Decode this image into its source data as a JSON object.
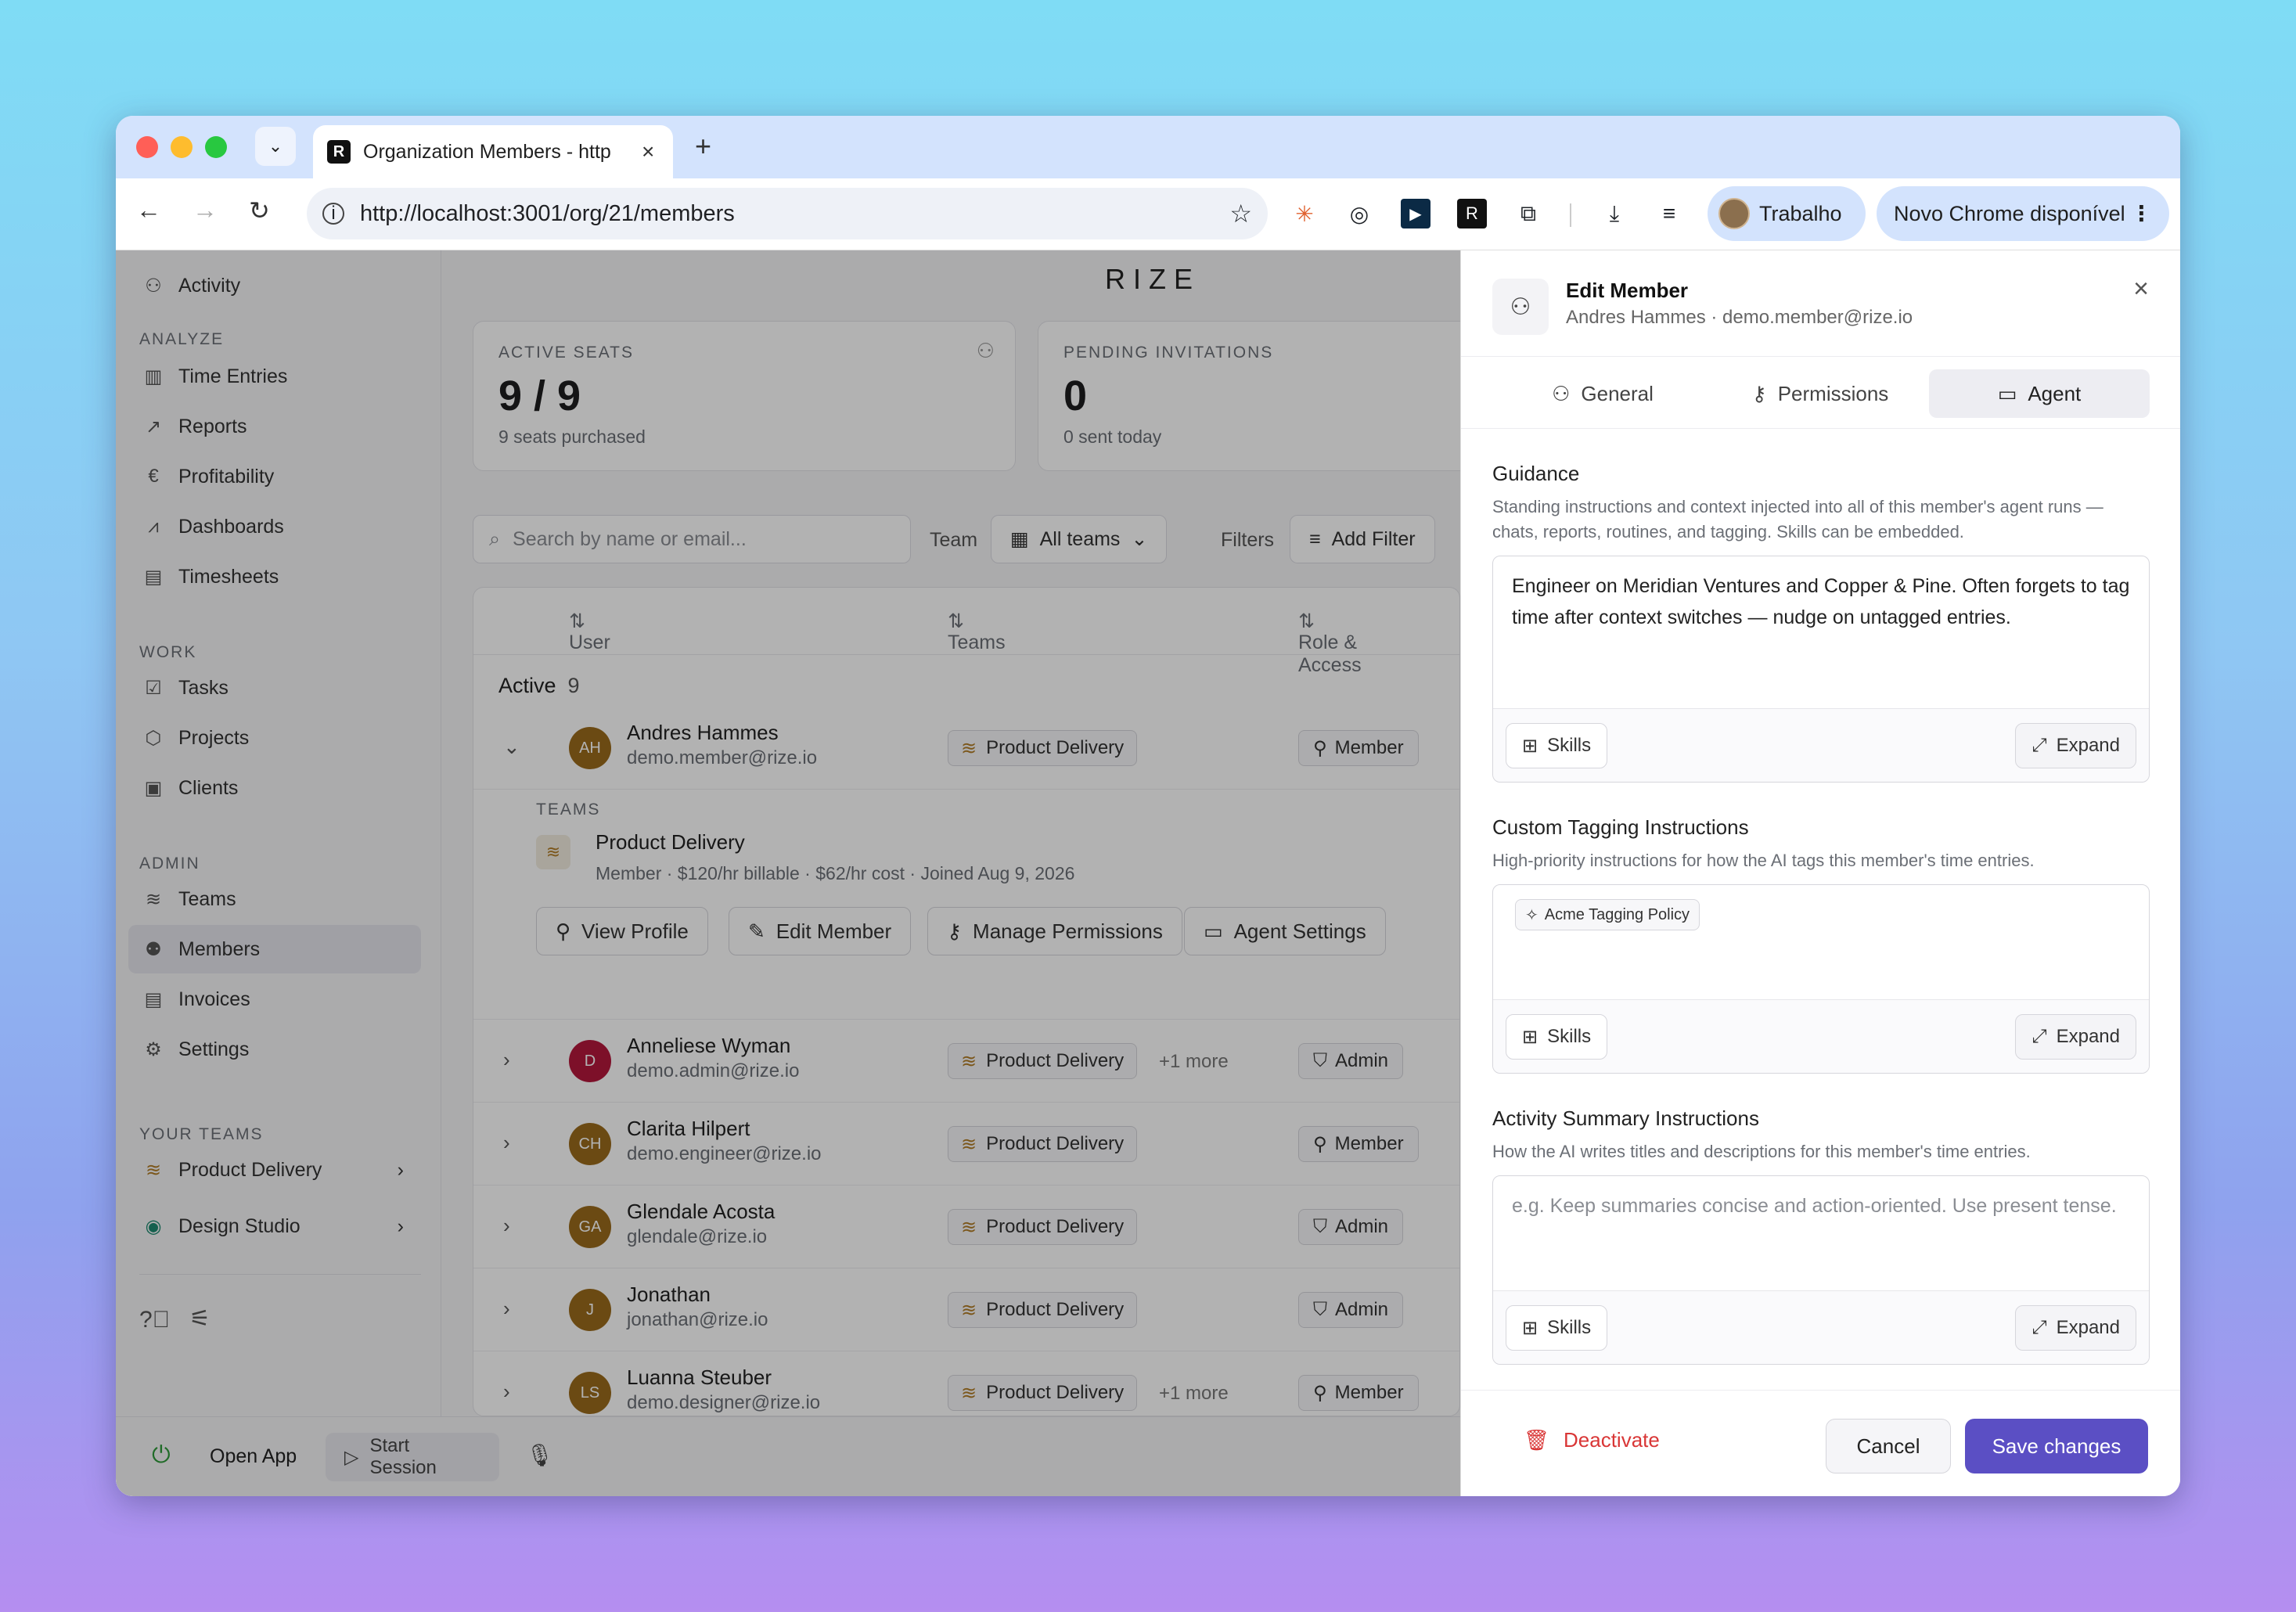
{
  "browser": {
    "tab_title": "Organization Members - http",
    "url": "http://localhost:3001/org/21/members",
    "profile_name": "Trabalho",
    "update_label": "Novo Chrome disponível",
    "favicon_letter": "R"
  },
  "app": {
    "logo": "RIZE",
    "sidebar": {
      "top_item": "Activity",
      "sections": [
        {
          "title": "ANALYZE",
          "items": [
            "Time Entries",
            "Reports",
            "Profitability",
            "Dashboards",
            "Timesheets"
          ]
        },
        {
          "title": "WORK",
          "items": [
            "Tasks",
            "Projects",
            "Clients"
          ]
        },
        {
          "title": "ADMIN",
          "items": [
            "Teams",
            "Members",
            "Invoices",
            "Settings"
          ]
        },
        {
          "title": "YOUR TEAMS",
          "items": [
            "Product Delivery",
            "Design Studio"
          ]
        }
      ]
    },
    "bottom": {
      "open_app": "Open App",
      "start_session": "Start Session"
    },
    "stats": {
      "seats_label": "ACTIVE SEATS",
      "seats_value": "9 / 9",
      "seats_sub": "9 seats purchased",
      "invites_label": "PENDING INVITATIONS",
      "invites_value": "0",
      "invites_sub": "0 sent today"
    },
    "filters": {
      "search_placeholder": "Search by name or email...",
      "team_label": "Team",
      "team_value": "All teams",
      "filters_label": "Filters",
      "add_filter": "Add Filter"
    },
    "table": {
      "col_user": "User",
      "col_teams": "Teams",
      "col_role": "Role & Access",
      "group_label": "Active",
      "group_count": "9",
      "expanded": {
        "section": "TEAMS",
        "team": "Product Delivery",
        "detail": "Member · $120/hr billable · $62/hr cost · Joined Aug 9, 2026",
        "actions": [
          "View Profile",
          "Edit Member",
          "Manage Permissions",
          "Agent Settings"
        ]
      },
      "rows": [
        {
          "initials": "AH",
          "name": "Andres Hammes",
          "email": "demo.member@rize.io",
          "team": "Product Delivery",
          "more": "",
          "role": "Member",
          "color": "#9a6a1c"
        },
        {
          "initials": "D",
          "name": "Anneliese Wyman",
          "email": "demo.admin@rize.io",
          "team": "Product Delivery",
          "more": "+1 more",
          "role": "Admin",
          "color": "#b3173c"
        },
        {
          "initials": "CH",
          "name": "Clarita Hilpert",
          "email": "demo.engineer@rize.io",
          "team": "Product Delivery",
          "more": "",
          "role": "Member",
          "color": "#9a6a1c"
        },
        {
          "initials": "GA",
          "name": "Glendale Acosta",
          "email": "glendale@rize.io",
          "team": "Product Delivery",
          "more": "",
          "role": "Admin",
          "color": "#9a6a1c"
        },
        {
          "initials": "J",
          "name": "Jonathan",
          "email": "jonathan@rize.io",
          "team": "Product Delivery",
          "more": "",
          "role": "Admin",
          "color": "#9a6a1c"
        },
        {
          "initials": "LS",
          "name": "Luanna Steuber",
          "email": "demo.designer@rize.io",
          "team": "Product Delivery",
          "more": "+1 more",
          "role": "Member",
          "color": "#9a6a1c"
        }
      ]
    }
  },
  "panel": {
    "title": "Edit Member",
    "subtitle": "Andres Hammes · demo.member@rize.io",
    "tabs": [
      "General",
      "Permissions",
      "Agent"
    ],
    "guidance_title": "Guidance",
    "guidance_desc": "Standing instructions and context injected into all of this member's agent runs — chats, reports, routines, and tagging. Skills can be embedded.",
    "guidance_value": "Engineer on Meridian Ventures and Copper & Pine. Often forgets to tag time after context switches — nudge on untagged entries.",
    "tagging_title": "Custom Tagging Instructions",
    "tagging_desc": "High-priority instructions for how the AI tags this member's time entries.",
    "tagging_chip": "Acme Tagging Policy",
    "summary_title": "Activity Summary Instructions",
    "summary_desc": "How the AI writes titles and descriptions for this member's time entries.",
    "summary_placeholder": "e.g. Keep summaries concise and action-oriented. Use present tense.",
    "skills_label": "Skills",
    "expand_label": "Expand",
    "deactivate": "Deactivate",
    "cancel": "Cancel",
    "save": "Save changes"
  }
}
